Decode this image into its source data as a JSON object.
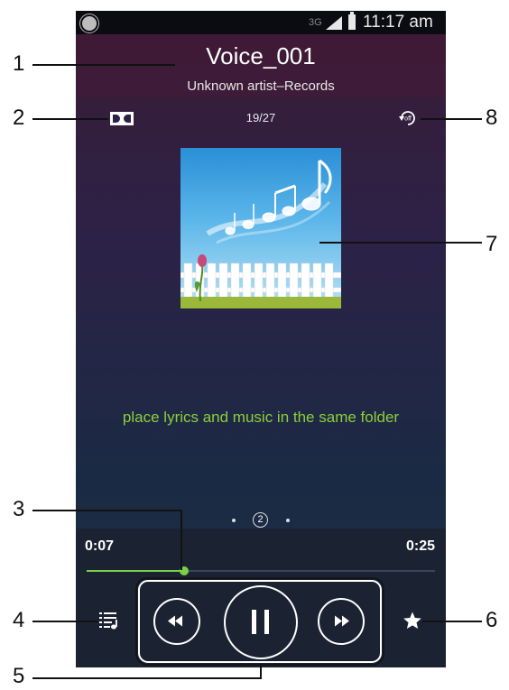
{
  "status_bar": {
    "network": "3G",
    "time": "11:17 am"
  },
  "track": {
    "title": "Voice_001",
    "subtitle": "Unknown artist–Records",
    "count": "19/27"
  },
  "lyrics_message": "place lyrics and music in the same folder",
  "page_indicator": {
    "current": "2"
  },
  "playback": {
    "elapsed": "0:07",
    "total": "0:25",
    "progress_fraction": 0.28
  },
  "callouts": {
    "c1": "1",
    "c2": "2",
    "c3": "3",
    "c4": "4",
    "c5": "5",
    "c6": "6",
    "c7": "7",
    "c8": "8"
  },
  "icons": {
    "status_app": "app-notification-icon",
    "signal": "signal-strength-icon",
    "battery": "battery-icon",
    "sound_effect": "dolby-icon",
    "repeat": "repeat-off-icon",
    "album_art": "album-art-music-notes",
    "playlist": "playlist-icon",
    "favorite": "star-icon",
    "rewind": "rewind-icon",
    "pause": "pause-icon",
    "fast_forward": "fast-forward-icon"
  },
  "colors": {
    "accent_green": "#7bd046",
    "lyrics_green": "#8bcf3a"
  }
}
